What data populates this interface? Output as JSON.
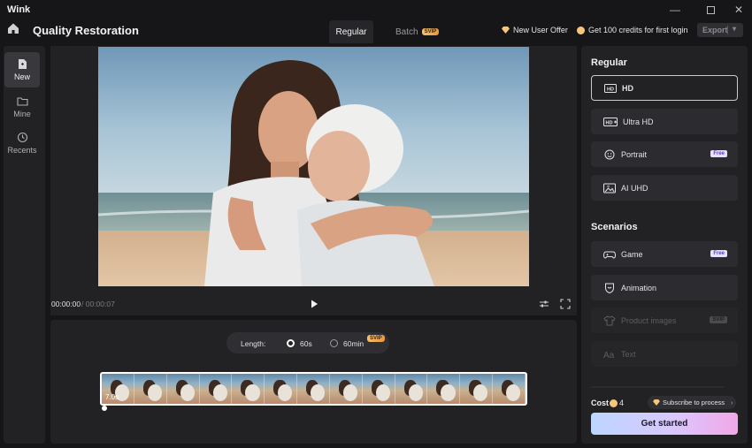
{
  "window": {
    "app_name": "Wink"
  },
  "header": {
    "title": "Quality Restoration",
    "tabs": [
      {
        "label": "Regular",
        "active": true
      },
      {
        "label": "Batch",
        "badge": "SVIP"
      }
    ],
    "new_user_offer": "New User Offer",
    "credits_offer": "Get 100 credits for first login",
    "export_label": "Export"
  },
  "sidebar": {
    "items": [
      {
        "label": "New",
        "icon": "new-file-icon",
        "active": true
      },
      {
        "label": "Mine",
        "icon": "folder-icon"
      },
      {
        "label": "Recents",
        "icon": "clock-icon"
      }
    ]
  },
  "player": {
    "current_time": "00:00:00",
    "total_time": "/ 00:00:07"
  },
  "timeline": {
    "length_label": "Length:",
    "options": [
      {
        "label": "60s",
        "selected": true
      },
      {
        "label": "60min",
        "badge": "SVIP"
      }
    ],
    "strip_time": "7.0s",
    "frame_count": 13
  },
  "right_panel": {
    "regular_title": "Regular",
    "regular_options": [
      {
        "label": "HD",
        "icon": "hd-icon",
        "selected": true
      },
      {
        "label": "Ultra HD",
        "icon": "hd-plus-icon"
      },
      {
        "label": "Portrait",
        "icon": "face-icon",
        "badge": "Free"
      },
      {
        "label": "AI UHD",
        "icon": "ai-image-icon"
      }
    ],
    "scenarios_title": "Scenarios",
    "scenario_options": [
      {
        "label": "Game",
        "icon": "gamepad-icon",
        "badge": "Free"
      },
      {
        "label": "Animation",
        "icon": "shield-icon"
      },
      {
        "label": "Product images",
        "icon": "shirt-icon",
        "badge": "SVIP",
        "disabled": true
      },
      {
        "label": "Text",
        "icon": "text-icon",
        "disabled": true
      }
    ],
    "cost_label": "Cost",
    "cost_value": "4",
    "subscribe_label": "Subscribe to process",
    "cta_label": "Get started"
  },
  "colors": {
    "accent_gradient_start": "#bcd6ff",
    "accent_gradient_end": "#f2a8e6",
    "panel_bg": "#222225"
  }
}
